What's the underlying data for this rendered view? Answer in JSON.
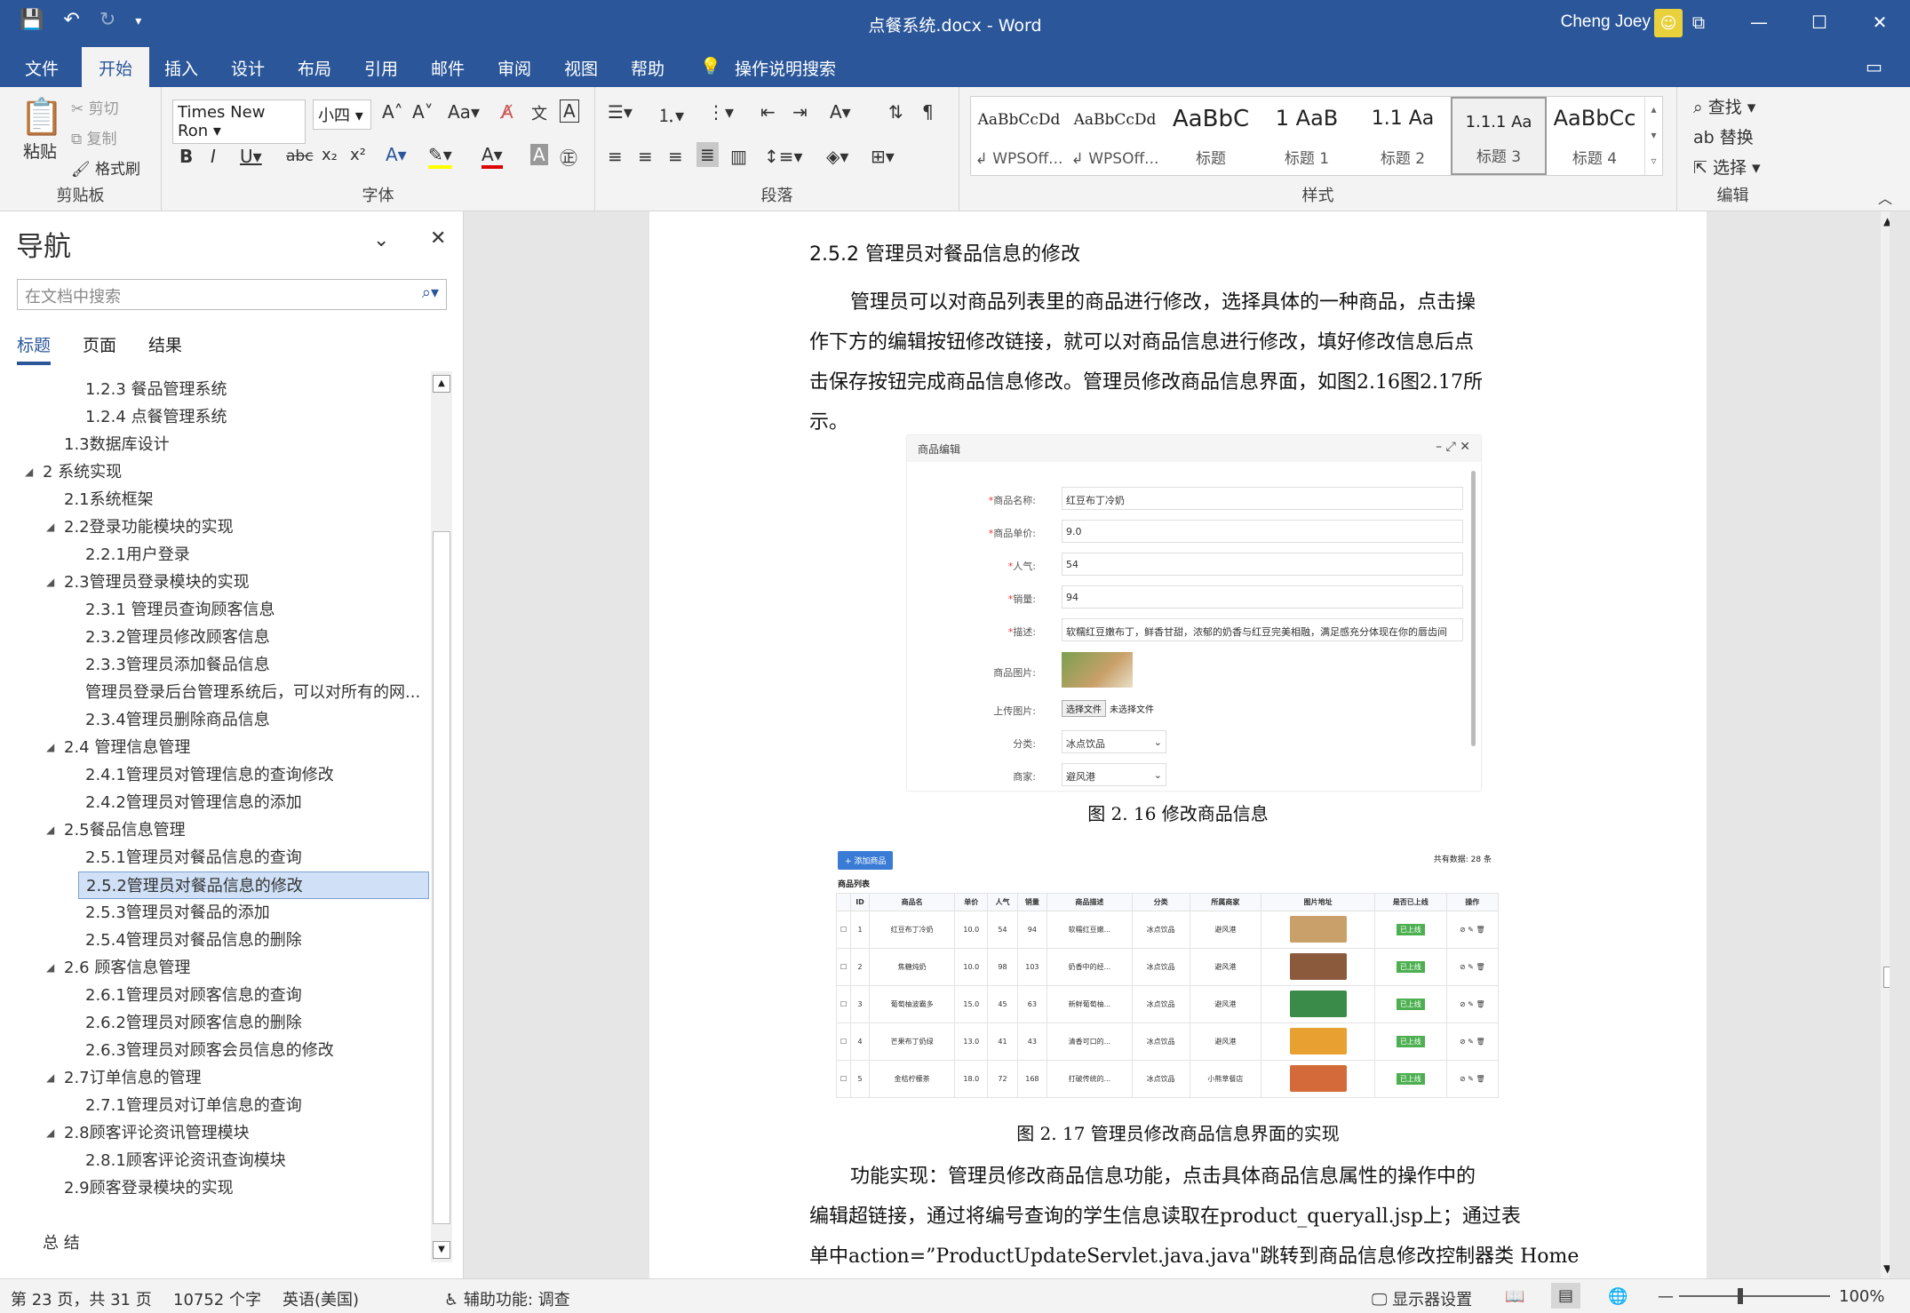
{
  "app": {
    "title": "点餐系统.docx  -  Word",
    "user": "Cheng Joey"
  },
  "tabs": [
    "文件",
    "开始",
    "插入",
    "设计",
    "布局",
    "引用",
    "邮件",
    "审阅",
    "视图",
    "帮助",
    "操作说明搜索"
  ],
  "ribbon": {
    "clipboard": {
      "paste": "粘贴",
      "cut": "剪切",
      "copy": "复制",
      "format_painter": "格式刷",
      "label": "剪贴板"
    },
    "font": {
      "name": "Times New Ron",
      "size": "小四",
      "label": "字体"
    },
    "paragraph": {
      "label": "段落"
    },
    "styles": {
      "label": "样式",
      "items": [
        {
          "preview": "AaBbCcDd",
          "name": "↲ WPSOff..."
        },
        {
          "preview": "AaBbCcDd",
          "name": "↲ WPSOff..."
        },
        {
          "preview": "AaBbC",
          "name": "标题"
        },
        {
          "preview": "1  AaB",
          "name": "标题 1"
        },
        {
          "preview": "1.1  Aa",
          "name": "标题 2"
        },
        {
          "preview": "1.1.1  Aa",
          "name": "标题 3"
        },
        {
          "preview": "AaBbCc",
          "name": "标题 4"
        }
      ]
    },
    "editing": {
      "find": "查找",
      "replace": "替换",
      "select": "选择",
      "label": "编辑"
    }
  },
  "nav": {
    "title": "导航",
    "search_placeholder": "在文档中搜索",
    "tabs": [
      "标题",
      "页面",
      "结果"
    ],
    "items": [
      {
        "text": "1.2.3 餐品管理系统",
        "level": 3
      },
      {
        "text": "1.2.4 点餐管理系统",
        "level": 3
      },
      {
        "text": "1.3数据库设计",
        "level": 2
      },
      {
        "text": "2 系统实现",
        "level": 1,
        "exp": true
      },
      {
        "text": "2.1系统框架",
        "level": 2
      },
      {
        "text": "2.2登录功能模块的实现",
        "level": 2,
        "exp": true
      },
      {
        "text": "2.2.1用户登录",
        "level": 3
      },
      {
        "text": "2.3管理员登录模块的实现",
        "level": 2,
        "exp": true
      },
      {
        "text": "2.3.1 管理员查询顾客信息",
        "level": 3
      },
      {
        "text": "2.3.2管理员修改顾客信息",
        "level": 3
      },
      {
        "text": "2.3.3管理员添加餐品信息",
        "level": 3
      },
      {
        "text": "管理员登录后台管理系统后，可以对所有的网...",
        "level": 3
      },
      {
        "text": "2.3.4管理员删除商品信息",
        "level": 3
      },
      {
        "text": "2.4 管理信息管理",
        "level": 2,
        "exp": true
      },
      {
        "text": "2.4.1管理员对管理信息的查询修改",
        "level": 3
      },
      {
        "text": "2.4.2管理员对管理信息的添加",
        "level": 3
      },
      {
        "text": "2.5餐品信息管理",
        "level": 2,
        "exp": true
      },
      {
        "text": "2.5.1管理员对餐品信息的查询",
        "level": 3
      },
      {
        "text": "2.5.2管理员对餐品信息的修改",
        "level": 3,
        "sel": true
      },
      {
        "text": "2.5.3管理员对餐品的添加",
        "level": 3
      },
      {
        "text": "2.5.4管理员对餐品信息的删除",
        "level": 3
      },
      {
        "text": "2.6 顾客信息管理",
        "level": 2,
        "exp": true
      },
      {
        "text": "2.6.1管理员对顾客信息的查询",
        "level": 3
      },
      {
        "text": "2.6.2管理员对顾客信息的删除",
        "level": 3
      },
      {
        "text": "2.6.3管理员对顾客会员信息的修改",
        "level": 3
      },
      {
        "text": "2.7订单信息的管理",
        "level": 2,
        "exp": true
      },
      {
        "text": "2.7.1管理员对订单信息的查询",
        "level": 3
      },
      {
        "text": "2.8顾客评论资讯管理模块",
        "level": 2,
        "exp": true
      },
      {
        "text": "2.8.1顾客评论资讯查询模块",
        "level": 3
      },
      {
        "text": "2.9顾客登录模块的实现",
        "level": 2
      },
      {
        "text": "",
        "level": 2
      },
      {
        "text": "总 结",
        "level": 1
      }
    ]
  },
  "doc": {
    "heading": "2.5.2 管理员对餐品信息的修改",
    "para1": [
      "管理员可以对商品列表里的商品进行修改，选择具体的一种商品，点击操",
      "作下方的编辑按钮修改链接，就可以对商品信息进行修改，填好修改信息后点",
      "击保存按钮完成商品信息修改。管理员修改商品信息界面，如图2.16图2.17所",
      "示。"
    ],
    "fig1": {
      "title": "商品编辑",
      "fields": [
        {
          "label": "商品名称:",
          "value": "红豆布丁冷奶",
          "req": true
        },
        {
          "label": "商品单价:",
          "value": "9.0",
          "req": true
        },
        {
          "label": "人气:",
          "value": "54",
          "req": true
        },
        {
          "label": "销量:",
          "value": "94",
          "req": true
        },
        {
          "label": "描述:",
          "value": "软糯红豆嫩布丁，鲜香甘甜，浓郁的奶香与红豆完美相融，满足感充分体现在你的唇齿间",
          "req": true
        }
      ],
      "image_label": "商品图片:",
      "upload_label": "上传图片:",
      "upload_btn": "选择文件",
      "upload_none": "未选择文件",
      "category_label": "分类:",
      "category": "冰点饮品",
      "merchant_label": "商家:",
      "merchant": "避风港"
    },
    "caption1": "图 2. 16 修改商品信息",
    "fig2": {
      "add_btn": "+ 添加商品",
      "list_title": "商品列表",
      "total": "共有数据: 28 条",
      "headers": [
        "",
        "ID",
        "商品名",
        "单价",
        "人气",
        "销量",
        "商品描述",
        "分类",
        "所属商家",
        "图片地址",
        "是否已上线",
        "操作"
      ],
      "rows": [
        [
          "1",
          "红豆布丁冷奶",
          "10.0",
          "54",
          "94",
          "软糯红豆嫩...",
          "冰点饮品",
          "避风港",
          "#c9a06a"
        ],
        [
          "2",
          "焦糖炖奶",
          "10.0",
          "98",
          "103",
          "奶香中的经...",
          "冰点饮品",
          "避风港",
          "#8b5a3c"
        ],
        [
          "3",
          "葡萄柚波霸多",
          "15.0",
          "45",
          "63",
          "新鲜葡萄柚...",
          "冰点饮品",
          "避风港",
          "#3a8a4a"
        ],
        [
          "4",
          "芒果布丁奶绿",
          "13.0",
          "41",
          "43",
          "清香可口的...",
          "冰点饮品",
          "避风港",
          "#e8a030"
        ],
        [
          "5",
          "金桔柠檬茶",
          "18.0",
          "72",
          "168",
          "打破传统的...",
          "冰点饮品",
          "小熊草餐店",
          "#d46a3a"
        ]
      ],
      "online": "已上线",
      "ops": "⊘ ✎ 🗑"
    },
    "caption2": "图 2. 17 管理员修改商品信息界面的实现",
    "para2": [
      "功能实现：管理员修改商品信息功能，点击具体商品信息属性的操作中的",
      "编辑超链接，通过将编号查询的学生信息读取在product_queryall.jsp上；通过表",
      "单中action=”ProductUpdateServlet.java.java\"跳转到商品信息修改控制器类  Home"
    ]
  },
  "status": {
    "page": "第 23 页，共 31 页",
    "words": "10752 个字",
    "lang": "英语(美国)",
    "access": "辅助功能: 调查",
    "display": "显示器设置",
    "zoom": "100%"
  }
}
